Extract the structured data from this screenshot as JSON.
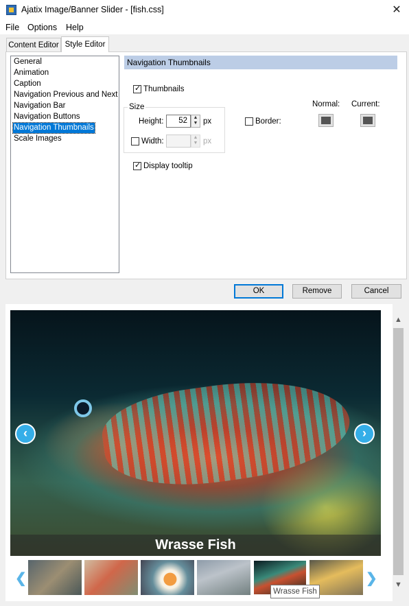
{
  "window": {
    "title": "Ajatix Image/Banner Slider - [fish.css]",
    "close_glyph": "✕",
    "app_icon": "app-icon"
  },
  "menu": [
    {
      "label": "File"
    },
    {
      "label": "Options"
    },
    {
      "label": "Help"
    }
  ],
  "tabs": [
    {
      "label": "Content Editor",
      "active": false
    },
    {
      "label": "Style Editor",
      "active": true
    }
  ],
  "categories": [
    {
      "label": "General"
    },
    {
      "label": "Animation"
    },
    {
      "label": "Caption"
    },
    {
      "label": "Navigation Previous and Next"
    },
    {
      "label": "Navigation Bar"
    },
    {
      "label": "Navigation Buttons"
    },
    {
      "label": "Navigation Thumbnails",
      "selected": true
    },
    {
      "label": "Scale Images"
    }
  ],
  "section": {
    "title": "Navigation Thumbnails",
    "thumbnails_label": "Thumbnails",
    "thumbnails_checked": true,
    "size_group": "Size",
    "height_label": "Height:",
    "height_value": "52",
    "height_unit": "px",
    "width_label": "Width:",
    "width_value": "",
    "width_unit": "px",
    "width_checked": false,
    "border_label": "Border:",
    "border_checked": false,
    "normal_label": "Normal:",
    "current_label": "Current:",
    "border_color": "#555555",
    "tooltip_label": "Display tooltip",
    "tooltip_checked": true
  },
  "buttons": {
    "ok": "OK",
    "remove": "Remove",
    "cancel": "Cancel"
  },
  "preview": {
    "caption": "Wrasse Fish",
    "prev_glyph": "‹",
    "next_glyph": "›",
    "thumb_prev_glyph": "❮",
    "thumb_next_glyph": "❯",
    "tooltip": "Wrasse Fish",
    "accent": "#35aee8",
    "scroll_up_glyph": "▲",
    "scroll_down_glyph": "▼"
  }
}
